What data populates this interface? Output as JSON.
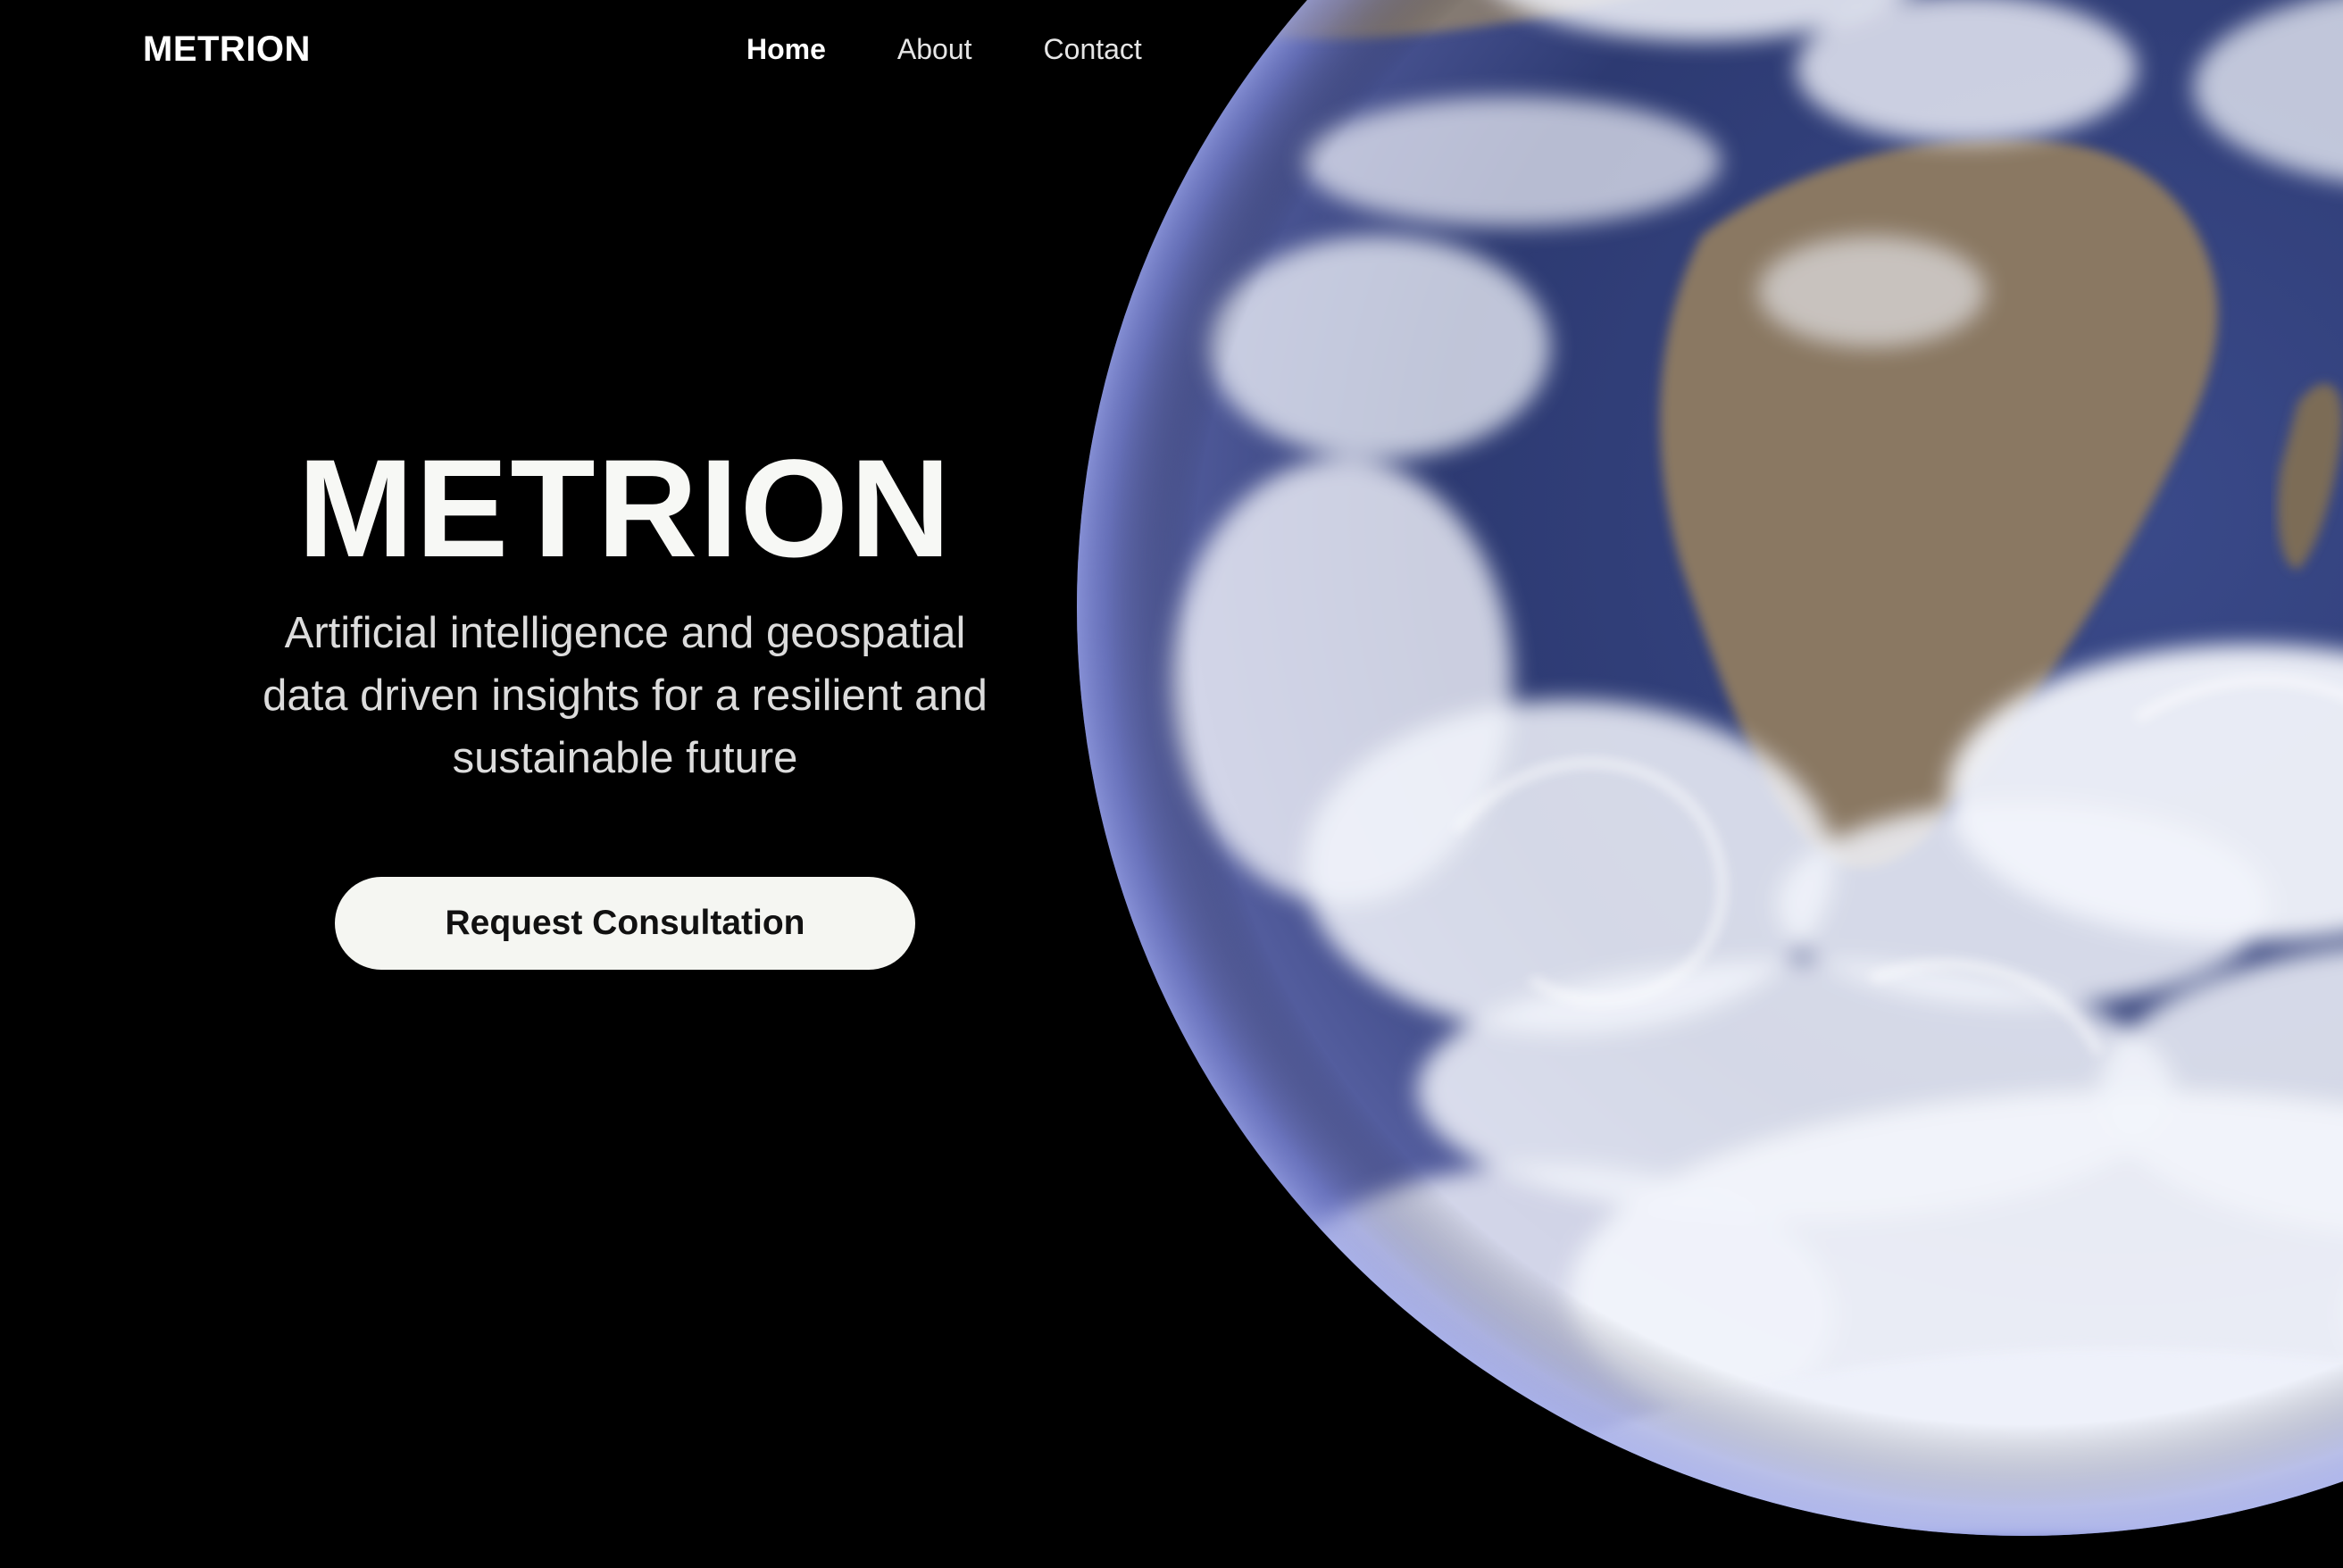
{
  "header": {
    "brand": "METRION",
    "nav": [
      {
        "label": "Home",
        "active": true
      },
      {
        "label": "About",
        "active": false
      },
      {
        "label": "Contact",
        "active": false
      }
    ]
  },
  "hero": {
    "title": "METRION",
    "subtitle": "Artificial intelligence and geospatial data driven insights for a resilient and sustainable future",
    "cta_label": "Request Consultation",
    "background_image": "earth-from-space"
  },
  "colors": {
    "background": "#000000",
    "text_primary": "#ffffff",
    "text_secondary": "#dcdcdc",
    "button_bg": "#f5f6f2",
    "button_text": "#111111",
    "ocean": "#33407a",
    "land": "#8a7862",
    "cloud": "#f2f4fb"
  }
}
